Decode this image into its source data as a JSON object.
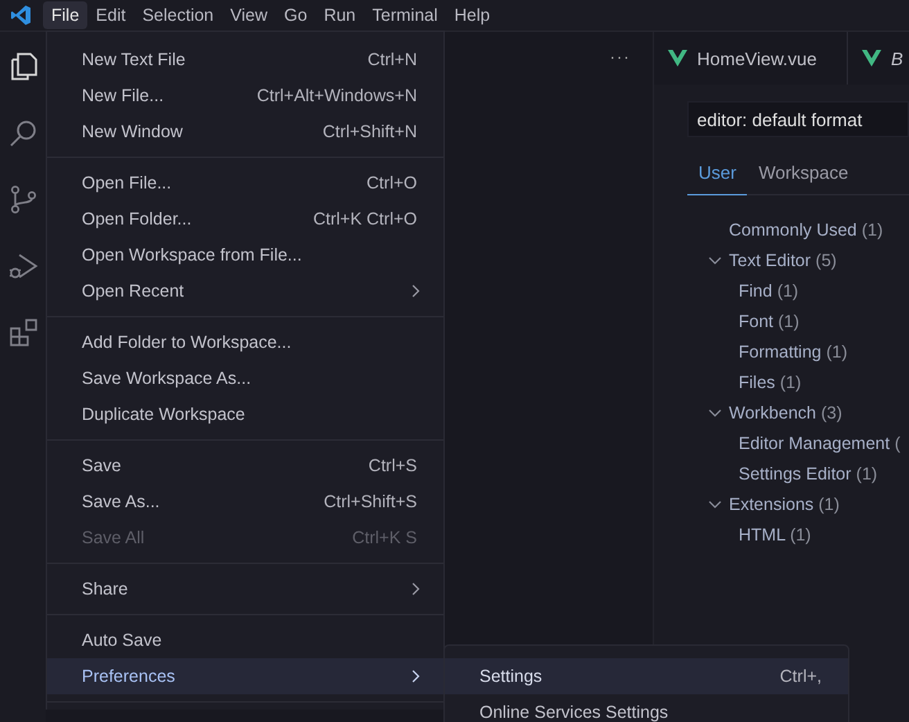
{
  "menubar": [
    {
      "label": "File",
      "selected": true
    },
    {
      "label": "Edit",
      "selected": false
    },
    {
      "label": "Selection",
      "selected": false
    },
    {
      "label": "View",
      "selected": false
    },
    {
      "label": "Go",
      "selected": false
    },
    {
      "label": "Run",
      "selected": false
    },
    {
      "label": "Terminal",
      "selected": false
    },
    {
      "label": "Help",
      "selected": false
    }
  ],
  "sidebar": {
    "more": "···"
  },
  "editor_tabs": [
    {
      "label": "HomeView.vue",
      "italic": false
    },
    {
      "label": "B",
      "italic": true
    }
  ],
  "settings": {
    "search_value": "editor: default format",
    "scope_tabs": [
      {
        "label": "User",
        "selected": true
      },
      {
        "label": "Workspace",
        "selected": false
      }
    ],
    "tree": [
      {
        "label": "Commonly Used",
        "count": "(1)"
      },
      {
        "label": "Text Editor",
        "count": "(5)",
        "expanded": true,
        "children": [
          {
            "label": "Find",
            "count": "(1)"
          },
          {
            "label": "Font",
            "count": "(1)"
          },
          {
            "label": "Formatting",
            "count": "(1)"
          },
          {
            "label": "Files",
            "count": "(1)"
          }
        ]
      },
      {
        "label": "Workbench",
        "count": "(3)",
        "expanded": true,
        "children": [
          {
            "label": "Editor Management",
            "count": "("
          },
          {
            "label": "Settings Editor",
            "count": "(1)"
          }
        ]
      },
      {
        "label": "Extensions",
        "count": "(1)",
        "expanded": true,
        "children": [
          {
            "label": "HTML",
            "count": "(1)"
          }
        ]
      }
    ]
  },
  "file_menu": [
    {
      "kind": "item",
      "label": "New Text File",
      "shortcut": "Ctrl+N",
      "submenu": false,
      "disabled": false,
      "selected": false
    },
    {
      "kind": "item",
      "label": "New File...",
      "shortcut": "Ctrl+Alt+Windows+N",
      "submenu": false,
      "disabled": false,
      "selected": false
    },
    {
      "kind": "item",
      "label": "New Window",
      "shortcut": "Ctrl+Shift+N",
      "submenu": false,
      "disabled": false,
      "selected": false
    },
    {
      "kind": "separator"
    },
    {
      "kind": "item",
      "label": "Open File...",
      "shortcut": "Ctrl+O",
      "submenu": false,
      "disabled": false,
      "selected": false
    },
    {
      "kind": "item",
      "label": "Open Folder...",
      "shortcut": "Ctrl+K Ctrl+O",
      "submenu": false,
      "disabled": false,
      "selected": false
    },
    {
      "kind": "item",
      "label": "Open Workspace from File...",
      "submenu": false,
      "disabled": false,
      "selected": false
    },
    {
      "kind": "item",
      "label": "Open Recent",
      "submenu": true,
      "disabled": false,
      "selected": false
    },
    {
      "kind": "separator"
    },
    {
      "kind": "item",
      "label": "Add Folder to Workspace...",
      "submenu": false,
      "disabled": false,
      "selected": false
    },
    {
      "kind": "item",
      "label": "Save Workspace As...",
      "submenu": false,
      "disabled": false,
      "selected": false
    },
    {
      "kind": "item",
      "label": "Duplicate Workspace",
      "submenu": false,
      "disabled": false,
      "selected": false
    },
    {
      "kind": "separator"
    },
    {
      "kind": "item",
      "label": "Save",
      "shortcut": "Ctrl+S",
      "submenu": false,
      "disabled": false,
      "selected": false
    },
    {
      "kind": "item",
      "label": "Save As...",
      "shortcut": "Ctrl+Shift+S",
      "submenu": false,
      "disabled": false,
      "selected": false
    },
    {
      "kind": "item",
      "label": "Save All",
      "shortcut": "Ctrl+K S",
      "submenu": false,
      "disabled": true,
      "selected": false
    },
    {
      "kind": "separator"
    },
    {
      "kind": "item",
      "label": "Share",
      "submenu": true,
      "disabled": false,
      "selected": false
    },
    {
      "kind": "separator"
    },
    {
      "kind": "item",
      "label": "Auto Save",
      "submenu": false,
      "disabled": false,
      "selected": false
    },
    {
      "kind": "item",
      "label": "Preferences",
      "submenu": true,
      "disabled": false,
      "selected": true
    },
    {
      "kind": "separator"
    }
  ],
  "preferences_submenu": [
    {
      "label": "Settings",
      "shortcut": "Ctrl+,",
      "selected": true
    },
    {
      "label": "Online Services Settings",
      "selected": false
    }
  ]
}
